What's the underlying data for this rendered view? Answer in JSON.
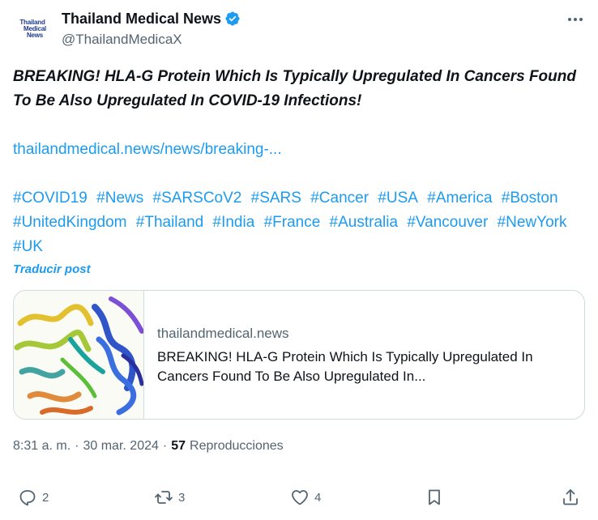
{
  "header": {
    "avatar_lines": [
      "Thailand",
      "Medical",
      "News"
    ],
    "display_name": "Thailand Medical News",
    "handle": "@ThailandMedicaX",
    "more_icon": "more-horizontal-icon",
    "verified_icon": "verified-badge-icon"
  },
  "tweet": {
    "headline": "BREAKING! HLA-G Protein Which Is Typically Upregulated In Cancers Found To Be Also Upregulated In COVID-19 Infections!",
    "link": "thailandmedical.news/news/breaking-...",
    "hashtags": [
      "#COVID19",
      "#News",
      "#SARSCoV2",
      "#SARS",
      "#Cancer",
      "#USA",
      "#America",
      "#Boston",
      "#UnitedKingdom",
      "#Thailand",
      "#India",
      "#France",
      "#Australia",
      "#Vancouver",
      "#NewYork",
      "#UK"
    ],
    "translate": "Traducir post"
  },
  "card": {
    "domain": "thailandmedical.news",
    "title": "BREAKING! HLA-G Protein Which Is Typically Upregulated In Cancers Found To Be Also Upregulated In..."
  },
  "meta": {
    "time": "8:31 a. m.",
    "separator": "·",
    "date": "30 mar. 2024",
    "views": "57",
    "views_label": "Reproducciones"
  },
  "actions": {
    "replies": "2",
    "reposts": "3",
    "likes": "4"
  },
  "colors": {
    "accent": "#1d9bf0",
    "text": "#0f1419",
    "muted": "#536471",
    "border": "#cfd9de"
  }
}
